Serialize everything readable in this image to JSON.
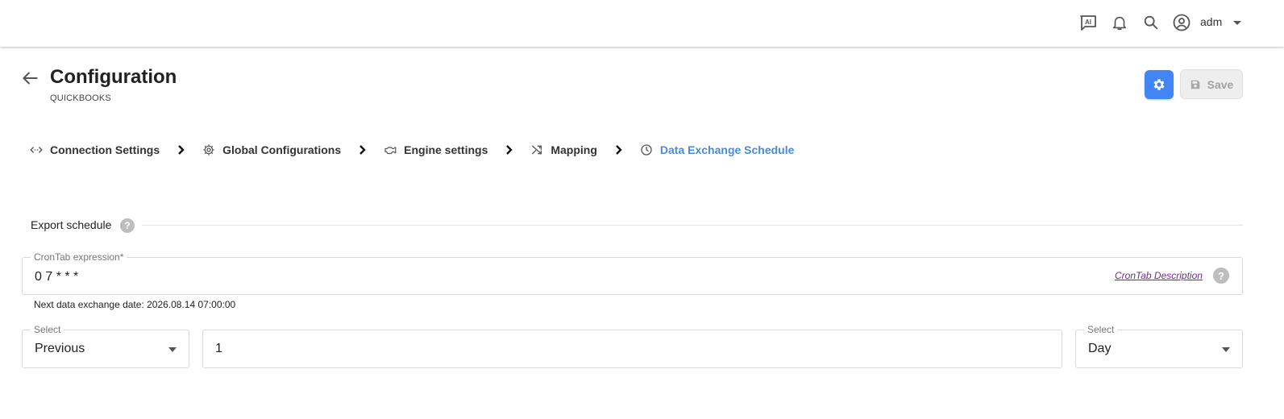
{
  "header": {
    "ai_label": "AI",
    "user": "adm"
  },
  "page": {
    "title": "Configuration",
    "subtitle": "QUICKBOOKS",
    "save_label": "Save"
  },
  "steps": [
    {
      "label": "Connection Settings",
      "icon": "code-arrows-icon"
    },
    {
      "label": "Global Configurations",
      "icon": "gear-icon"
    },
    {
      "label": "Engine settings",
      "icon": "engine-icon"
    },
    {
      "label": "Mapping",
      "icon": "shuffle-icon"
    },
    {
      "label": "Data Exchange Schedule",
      "icon": "clock-icon",
      "active": true
    }
  ],
  "schedule": {
    "section_label": "Export schedule",
    "help_mark": "?",
    "cron_legend": "CronTab expression*",
    "cron_value": "0 7 * * *",
    "cron_link": "CronTab Description",
    "next_date": "Next data exchange date: 2026.08.14 07:00:00",
    "period_legend": "Select",
    "period_value": "Previous",
    "amount_value": "1",
    "unit_legend": "Select",
    "unit_value": "Day"
  },
  "colors": {
    "accent": "#4285f4",
    "active_step": "#4a8ad8",
    "link": "#6b2d8a"
  }
}
